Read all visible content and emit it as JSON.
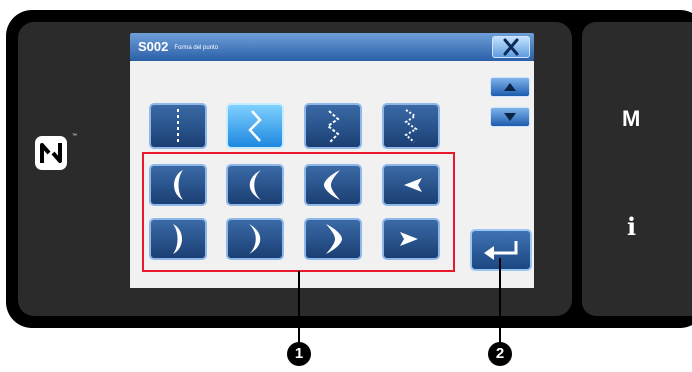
{
  "dialog": {
    "code": "S002",
    "subtitle": "Forma del punto",
    "close_icon": "close-x-icon",
    "scroll_up_icon": "triangle-up-icon",
    "scroll_down_icon": "triangle-down-icon",
    "enter_icon": "enter-return-icon"
  },
  "stitch_types": [
    {
      "icon": "straight-dashed-stitch-icon",
      "selected": false
    },
    {
      "icon": "zigzag-2-step-stitch-icon",
      "selected": true
    },
    {
      "icon": "zigzag-3-step-stitch-icon",
      "selected": false
    },
    {
      "icon": "zigzag-4-step-stitch-icon",
      "selected": false
    }
  ],
  "shape_buttons": [
    {
      "icon": "left-bracket-shape-1-icon"
    },
    {
      "icon": "left-bracket-shape-2-icon"
    },
    {
      "icon": "left-bracket-shape-3-icon"
    },
    {
      "icon": "left-angle-shape-icon"
    },
    {
      "icon": "right-bracket-shape-1-icon"
    },
    {
      "icon": "right-bracket-shape-2-icon"
    },
    {
      "icon": "right-bracket-shape-3-icon"
    },
    {
      "icon": "right-angle-shape-icon"
    }
  ],
  "side": {
    "mode_label": "M",
    "info_label": "i",
    "nfc_icon": "nfc-icon",
    "trademark": "™"
  },
  "callouts": {
    "one": "❶",
    "two": "❷"
  },
  "colors": {
    "highlight": "#e8192c",
    "title_bar": "#2a5fa8",
    "selected_button": "#1e88e0"
  }
}
